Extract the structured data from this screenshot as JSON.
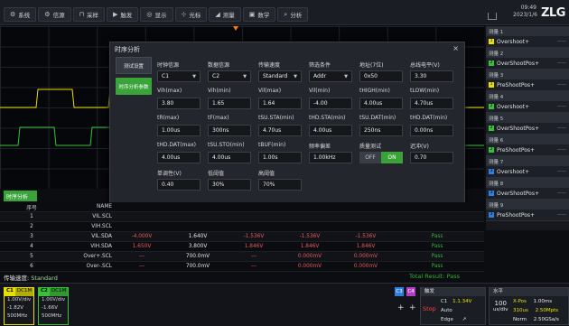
{
  "toolbar": {
    "items": [
      {
        "icon": "gear-icon",
        "label": "系统"
      },
      {
        "icon": "gear-icon",
        "label": "信源"
      },
      {
        "icon": "sample-icon",
        "label": "采样"
      },
      {
        "icon": "trigger-icon",
        "label": "触发"
      },
      {
        "icon": "display-icon",
        "label": "显示"
      },
      {
        "icon": "cursor-icon",
        "label": "光标"
      },
      {
        "icon": "measure-icon",
        "label": "测量"
      },
      {
        "icon": "math-icon",
        "label": "数学"
      },
      {
        "icon": "analysis-icon",
        "label": "分析"
      }
    ],
    "time": "09:49",
    "date": "2023/1/6",
    "logo": "ZLG"
  },
  "dialog": {
    "title": "时序分析",
    "close": "×",
    "tabs": [
      {
        "label": "测试设置",
        "active": false
      },
      {
        "label": "时序分析参数",
        "active": true
      }
    ],
    "fields": [
      {
        "label": "时钟信源",
        "value": "C1",
        "dropdown": true
      },
      {
        "label": "数据信源",
        "value": "C2",
        "dropdown": true
      },
      {
        "label": "传输速度",
        "value": "Standard",
        "dropdown": true
      },
      {
        "label": "筛选条件",
        "value": "Addr",
        "dropdown": true
      },
      {
        "label": "地址(7位)",
        "value": "0x50",
        "dropdown": false
      },
      {
        "label": "总线电平(V)",
        "value": "3.30",
        "dropdown": false
      },
      {
        "label": "Vih(max)",
        "value": "3.80",
        "dropdown": false
      },
      {
        "label": "Vih(min)",
        "value": "1.65",
        "dropdown": false
      },
      {
        "label": "Vil(max)",
        "value": "1.64",
        "dropdown": false
      },
      {
        "label": "Vil(min)",
        "value": "-4.00",
        "dropdown": false
      },
      {
        "label": "tHIGH(min)",
        "value": "4.00us",
        "dropdown": false
      },
      {
        "label": "tLOW(min)",
        "value": "4.70us",
        "dropdown": false
      },
      {
        "label": "tR(max)",
        "value": "1.00us",
        "dropdown": false
      },
      {
        "label": "tF(max)",
        "value": "300ns",
        "dropdown": false
      },
      {
        "label": "tSU.STA(min)",
        "value": "4.70us",
        "dropdown": false
      },
      {
        "label": "tHD.STA(min)",
        "value": "4.00us",
        "dropdown": false
      },
      {
        "label": "tSU.DAT(min)",
        "value": "250ns",
        "dropdown": false
      },
      {
        "label": "tHD.DAT(min)",
        "value": "0.00ns",
        "dropdown": false
      },
      {
        "label": "tHD.DAT(max)",
        "value": "4.00us",
        "dropdown": false
      },
      {
        "label": "tSU.STO(min)",
        "value": "4.00us",
        "dropdown": false
      },
      {
        "label": "tBUF(min)",
        "value": "1.00s",
        "dropdown": false
      },
      {
        "label": "频率偏差",
        "value": "1.00kHz",
        "dropdown": false
      },
      {
        "label": "质量测试",
        "toggle": true,
        "off": "OFF",
        "on": "ON"
      },
      {
        "label": "迟冲(V)",
        "value": "0.70",
        "dropdown": false
      },
      {
        "label": "单调性(V)",
        "value": "0.40",
        "dropdown": false
      },
      {
        "label": "低阈值",
        "value": "30%",
        "dropdown": false
      },
      {
        "label": "高阈值",
        "value": "70%",
        "dropdown": false
      }
    ]
  },
  "measure_panel": {
    "groups": [
      {
        "group": "测量 1",
        "ch": "1",
        "color": "#e8e100",
        "name": "Overshoot+",
        "val": "-----"
      },
      {
        "group": "测量 2",
        "ch": "2",
        "color": "#39c239",
        "name": "OverShootPos+",
        "val": "-----"
      },
      {
        "group": "测量 3",
        "ch": "1",
        "color": "#e8e100",
        "name": "PreShootPos+",
        "val": "-----"
      },
      {
        "group": "测量 4",
        "ch": "2",
        "color": "#39c239",
        "name": "Overshoot+",
        "val": "-----"
      },
      {
        "group": "测量 5",
        "ch": "2",
        "color": "#39c239",
        "name": "OverShootPos+",
        "val": "-----"
      },
      {
        "group": "测量 6",
        "ch": "2",
        "color": "#39c239",
        "name": "PreShootPos+",
        "val": "-----"
      },
      {
        "group": "测量 7",
        "ch": "3",
        "color": "#2f7fe0",
        "name": "Overshoot+",
        "val": "-----"
      },
      {
        "group": "测量 8",
        "ch": "3",
        "color": "#2f7fe0",
        "name": "OverShootPos+",
        "val": "-----"
      },
      {
        "group": "测量 9",
        "ch": "3",
        "color": "#2f7fe0",
        "name": "PreShootPos+",
        "val": "-----"
      }
    ]
  },
  "table": {
    "tab": "时序分析",
    "headers": {
      "idx": "序号",
      "name": "NAME"
    },
    "rows": [
      {
        "idx": "1",
        "name": "VIL.SCL",
        "v1": "",
        "v2": "",
        "v3": "",
        "v4": "",
        "v5": "",
        "res": ""
      },
      {
        "idx": "2",
        "name": "VIH.SCL",
        "v1": "",
        "v2": "",
        "v3": "",
        "v4": "",
        "v5": "",
        "res": ""
      },
      {
        "idx": "3",
        "name": "VIL.SDA",
        "v1": "-4.000V",
        "v2": "1.640V",
        "v3": "-1.536V",
        "v4": "-1.536V",
        "v5": "-1.536V",
        "res": "Pass"
      },
      {
        "idx": "4",
        "name": "VIH.SDA",
        "v1": "1.650V",
        "v2": "3.800V",
        "v3": "1.846V",
        "v4": "1.846V",
        "v5": "1.846V",
        "res": "Pass"
      },
      {
        "idx": "5",
        "name": "Over+.SCL",
        "v1": "---",
        "v2": "700.0mV",
        "v3": "---",
        "v4": "0.000mV",
        "v5": "0.000mV",
        "res": "Pass"
      },
      {
        "idx": "6",
        "name": "Over-.SCL",
        "v1": "---",
        "v2": "700.0mV",
        "v3": "---",
        "v4": "0.000mV",
        "v5": "0.000mV",
        "res": "Pass"
      }
    ]
  },
  "status": {
    "std_label": "传输速度:",
    "std_value": "Standard",
    "total": "Total Result: Pass"
  },
  "channels": [
    {
      "tag": "C1",
      "coupling": "DC1M",
      "color": "#e8e100",
      "div": "1.00V/div",
      "offset": "-1.82V",
      "bw": "500MHz"
    },
    {
      "tag": "C2",
      "coupling": "DC1M",
      "color": "#39c239",
      "div": "1.00V/div",
      "offset": "-1.66V",
      "bw": "500MHz"
    }
  ],
  "trigger": {
    "title": "触发",
    "state": "Stop",
    "source": "C1",
    "level": "1.1.34V",
    "mode": "Auto",
    "type": "Edge",
    "slope": "↗"
  },
  "horizontal": {
    "title": "水平",
    "scale_num": "100",
    "scale_unit": "us/div",
    "xpos_label": "X-Pos",
    "xpos": "1.00ms",
    "sample": "310us",
    "rate": "2.50Mpts",
    "norm_label": "Norm",
    "norm": "2.50GSa/s"
  },
  "ch_extra": [
    "C3",
    "C4"
  ]
}
